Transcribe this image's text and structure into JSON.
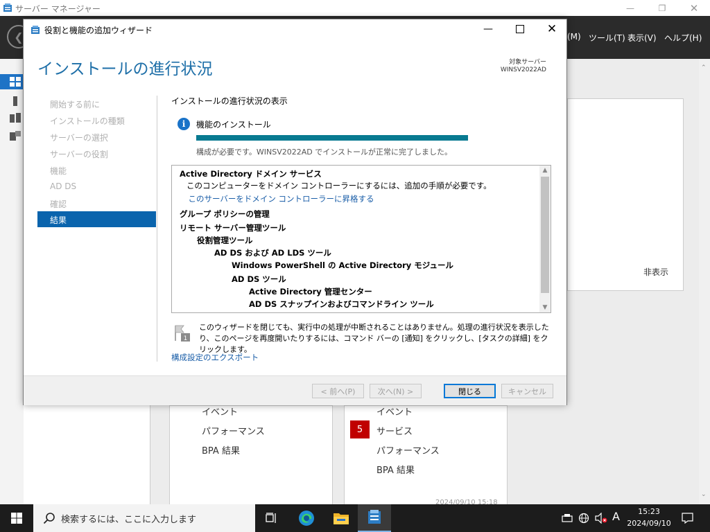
{
  "server_manager": {
    "title": "サーバー マネージャー",
    "menu": [
      "(M)",
      "ツール(T)",
      "表示(V)",
      "ヘルプ(H)"
    ],
    "hide_label": "非表示",
    "tile_left": [
      "イベント",
      "パフォーマンス",
      "BPA 結果"
    ],
    "tile_right": [
      "イベント",
      "サービス",
      "パフォーマンス",
      "BPA 結果"
    ],
    "services_badge": "5",
    "tile_timestamp": "2024/09/10 15:18"
  },
  "wizard": {
    "title": "役割と機能の追加ウィザード",
    "heading": "インストールの進行状況",
    "target_label": "対象サーバー",
    "target_server": "WINSV2022AD",
    "nav": [
      "開始する前に",
      "インストールの種類",
      "サーバーの選択",
      "サーバーの役割",
      "機能",
      "AD DS",
      "確認"
    ],
    "nav_active": "結果",
    "section_title": "インストールの進行状況の表示",
    "feature_install": "機能のインストール",
    "progress": 1.0,
    "status": "構成が必要です。WINSV2022AD でインストールが正常に完了しました。",
    "results": [
      {
        "text": "Active Directory ドメイン サービス",
        "bold": true,
        "level": 0
      },
      {
        "text": "このコンピューターをドメイン コントローラーにするには、追加の手順が必要です。",
        "bold": false,
        "level": 0.4
      },
      {
        "text": "このサーバーをドメイン コントローラーに昇格する",
        "link": true,
        "level": 0.5
      },
      {
        "text": "グループ ポリシーの管理",
        "bold": true,
        "level": 0
      },
      {
        "text": "リモート サーバー管理ツール",
        "bold": true,
        "level": 0
      },
      {
        "text": "役割管理ツール",
        "bold": true,
        "level": 1
      },
      {
        "text": "AD DS および AD LDS ツール",
        "bold": true,
        "level": 2
      },
      {
        "text": "Windows PowerShell の Active Directory モジュール",
        "bold": true,
        "level": 3
      },
      {
        "text": "AD DS ツール",
        "bold": true,
        "level": 3
      },
      {
        "text": "Active Directory 管理センター",
        "bold": true,
        "level": 4
      },
      {
        "text": "AD DS スナップインおよびコマンドライン ツール",
        "bold": true,
        "level": 4
      }
    ],
    "note": "このウィザードを閉じても、実行中の処理が中断されることはありません。処理の進行状況を表示したり、このページを再度開いたりするには、コマンド バーの [通知] をクリックし、[タスクの詳細] をクリックします。",
    "note_flag_number": "1",
    "export_link": "構成設定のエクスポート",
    "buttons": {
      "prev": "< 前へ(P)",
      "next": "次へ(N) >",
      "close": "閉じる",
      "cancel": "キャンセル"
    }
  },
  "taskbar": {
    "search_placeholder": "検索するには、ここに入力します",
    "ime_mode": "A",
    "time": "15:23",
    "date": "2024/09/10"
  }
}
